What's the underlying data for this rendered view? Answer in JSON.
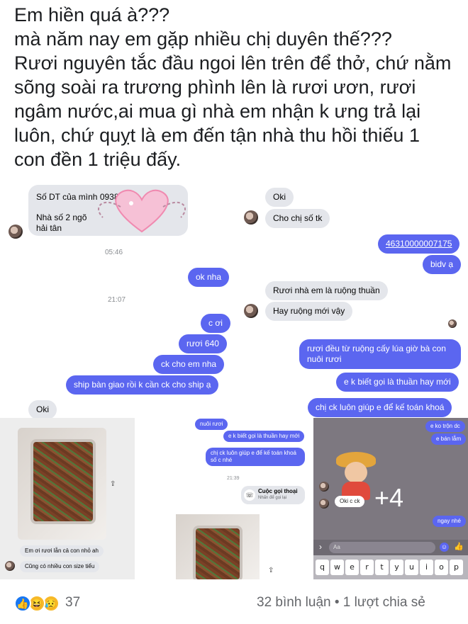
{
  "post": {
    "lines": [
      "Em hiền quá à???",
      "mà năm nay em gặp nhiều chị duyên thế???",
      "Rươi nguyên tắc đầu ngoi lên trên để thở, chứ nằm",
      "sõng soài ra trương phình lên là rươi ươn, rươi",
      "ngâm nước,ai mua gì nhà em nhận k ưng trả lại",
      "luôn, chứ quỵt là em đến tận nhà thu hồi thiếu 1",
      "con đền 1 triệu đấy."
    ]
  },
  "chat_left": {
    "received_top": [
      "Số DT của mình 0938833",
      "Nhà số 2 ngõ",
      "hải tân"
    ],
    "time_1": "05:46",
    "sent_ok": "ok nha",
    "time_2": "21:07",
    "sent_messages": [
      "c ơi",
      "rươi 640",
      "ck cho em nha",
      "ship bàn giao rồi k cần ck cho ship ạ"
    ],
    "received_oki": "Oki"
  },
  "chat_right": {
    "received": [
      "Oki",
      "Cho chị số tk"
    ],
    "sent_account": "46310000007175",
    "sent_bank": "bidv ạ",
    "received_2": [
      "Rươi nhà em là ruộng thuần",
      "Hay ruộng mới vậy"
    ],
    "sent_2": [
      "rươi đều từ ruộng cấy lúa giờ bà con",
      "nuôi rươi",
      "e k biết gọi là thuần hay mới",
      "chị ck luôn giúp e để kế toán khoá"
    ]
  },
  "photo_left": {
    "captions": [
      "Em ơi rươi lẫn cả con nhỏ ah",
      "Cũng có nhiều con size tiểu"
    ]
  },
  "mini_chat": {
    "sent": [
      "nuôi rươi",
      "e k biết gọi là thuần hay mới",
      "chị ck luôn giúp e để kế toán khoá",
      "số c nhé"
    ],
    "time": "21:39",
    "call_title": "Cuộc gọi thoại",
    "call_sub": "Nhấn để gọi lại"
  },
  "phone_pane": {
    "sent_top": [
      "e ko trộn dc",
      "e bán lẫm"
    ],
    "oki": "Oki c ck",
    "more_count": "+4",
    "ngay": "ngay nhé",
    "input_placeholder": "Aa",
    "keys": [
      "q",
      "w",
      "e",
      "r",
      "t",
      "y",
      "u",
      "i",
      "o",
      "p"
    ]
  },
  "footer": {
    "reaction_count": "37",
    "comments_shares": "32 bình luận • 1 lượt chia sẻ"
  },
  "colors": {
    "sent_bubble": "#5b66f0",
    "received_bubble": "#e4e6eb",
    "like_blue": "#1877f2",
    "haha_yellow": "#f7b928"
  }
}
